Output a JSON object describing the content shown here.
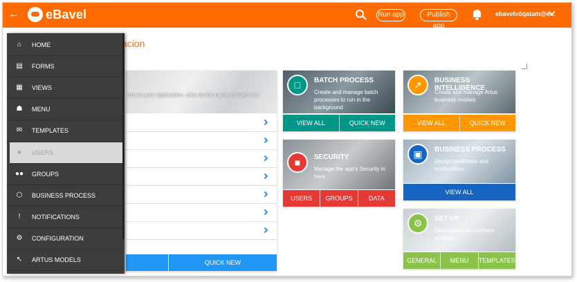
{
  "app": {
    "brand": "eBavel",
    "user": "ebavelvóqatam@e...",
    "run_label": "Run app",
    "publish_label": "Publish app"
  },
  "page": {
    "title": "tacion"
  },
  "sidebar": {
    "items": [
      {
        "label": "HOME",
        "icon": "home-icon"
      },
      {
        "label": "FORMS",
        "icon": "forms-icon"
      },
      {
        "label": "VIEWS",
        "icon": "views-icon"
      },
      {
        "label": "MENU",
        "icon": "menu-icon"
      },
      {
        "label": "TEMPLATES",
        "icon": "templates-icon"
      },
      {
        "label": "USERS",
        "icon": "users-icon"
      },
      {
        "label": "GROUPS",
        "icon": "groups-icon"
      },
      {
        "label": "BUSINESS PROCESS",
        "icon": "business-process-icon"
      },
      {
        "label": "NOTIFICATIONS",
        "icon": "notifications-icon"
      },
      {
        "label": "CONFIGURATION",
        "icon": "configuration-icon"
      },
      {
        "label": "ARTUS MODELS",
        "icon": "artus-models-icon"
      }
    ],
    "active_index": 5
  },
  "forms_card": {
    "description": "rms in your application, click on the name to open it in",
    "quick_new": "QUICK NEW"
  },
  "tiles": {
    "batch": {
      "title": "BATCH PROCESS",
      "desc": "Create and manage batch processes to run in the background",
      "btn1": "VIEW ALL",
      "btn2": "QUICK NEW",
      "color": "#009688"
    },
    "bi": {
      "title": "BUSINESS INTELLIGENCE",
      "desc": "Create and manage Artus business models",
      "btn1": "VIEW ALL",
      "btn2": "QUICK NEW",
      "color": "#ff9800"
    },
    "security": {
      "title": "SECURITY",
      "desc": "Manage the app's Security in here",
      "btn1": "USERS",
      "btn2": "GROUPS",
      "btn3": "DATA",
      "color": "#e53935"
    },
    "bp": {
      "title": "BUSINESS PROCESS",
      "desc": "Design workflows and notifications",
      "btn1": "VIEW ALL",
      "color": "#1565c0"
    },
    "setup": {
      "title": "SET UP",
      "desc": "Descripción de business process",
      "btn1": "GENERAL",
      "btn2": "MENU",
      "btn3": "TEMPLATES",
      "color": "#8bc34a"
    }
  },
  "colors": {
    "topbar": "#ff6b00",
    "sidebar": "#3d3d3d",
    "link": "#2196f3"
  }
}
